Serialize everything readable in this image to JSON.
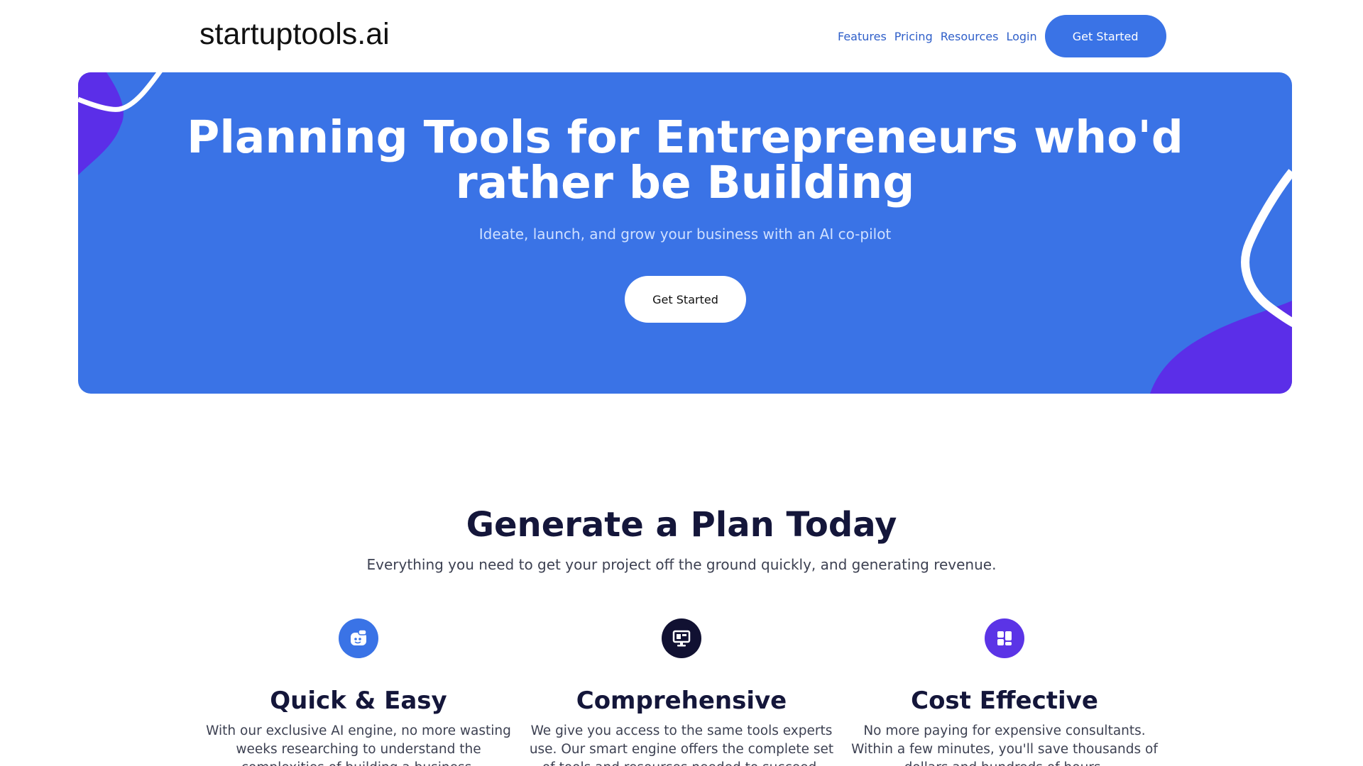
{
  "header": {
    "logo": "startuptools.ai",
    "nav": [
      "Features",
      "Pricing",
      "Resources",
      "Login"
    ],
    "cta": "Get Started"
  },
  "hero": {
    "title_line1": "Planning Tools for Entrepreneurs who'd",
    "title_line2": "rather be Building",
    "subtitle": "Ideate, launch, and grow your business with an AI co-pilot",
    "cta": "Get Started"
  },
  "section": {
    "title": "Generate a Plan Today",
    "subtitle": "Everything you need to get your project off the ground quickly, and generating revenue."
  },
  "features": [
    {
      "icon": "robot-chat-icon",
      "color": "#3a73e6",
      "title": "Quick & Easy",
      "desc": "With our exclusive AI engine, no more wasting weeks researching to understand the complexities of building a business."
    },
    {
      "icon": "monitor-icon",
      "color": "#111132",
      "title": "Comprehensive",
      "desc": "We give you access to the same tools experts use. Our smart engine offers the complete set of tools and resources needed to succeed."
    },
    {
      "icon": "dashboard-grid-icon",
      "color": "#5b34e6",
      "title": "Cost Effective",
      "desc": "No more paying for expensive consultants. Within a few minutes, you'll save thousands of dollars and hundreds of hours."
    }
  ],
  "colors": {
    "brand_blue": "#3a73e6",
    "accent_purple": "#5b2ee8",
    "dark_navy": "#14163a"
  }
}
